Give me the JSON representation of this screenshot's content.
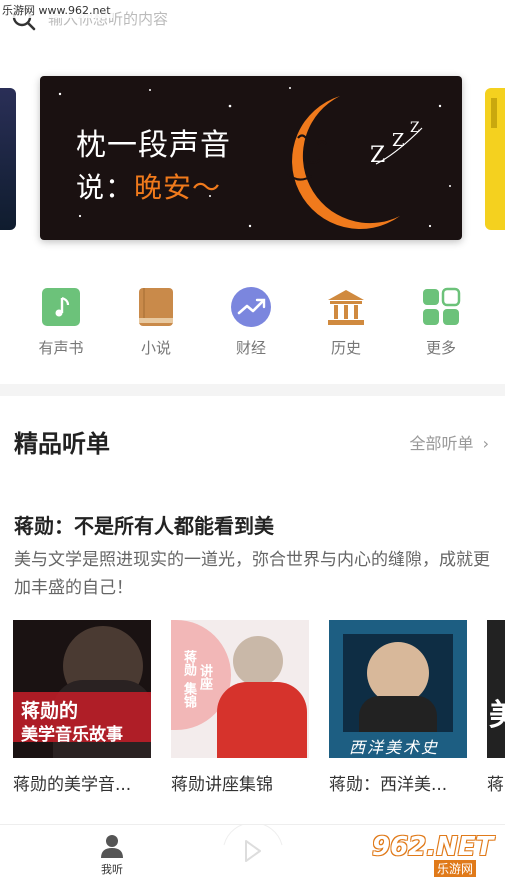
{
  "watermark_top": "乐游网 www.962.net",
  "search": {
    "placeholder": "输入你想听的内容"
  },
  "banner": {
    "line1": "枕一段声音",
    "line2_prefix": "说：",
    "line2_highlight": "晚安～",
    "snore": "z Z Z"
  },
  "categories": [
    {
      "label": "有声书",
      "icon": "music-book-icon",
      "color": "#6cc27a"
    },
    {
      "label": "小说",
      "icon": "book-icon",
      "color": "#c98a4a"
    },
    {
      "label": "财经",
      "icon": "trend-icon",
      "color": "#7b86de"
    },
    {
      "label": "历史",
      "icon": "temple-icon",
      "color": "#d08a3f"
    },
    {
      "label": "更多",
      "icon": "grid-icon",
      "color": "#6cc27a"
    }
  ],
  "section": {
    "title": "精品听单",
    "more": "全部听单"
  },
  "playlist": {
    "title": "蒋勋：不是所有人都能看到美",
    "desc": "美与文学是照进现实的一道光，弥合世界与内心的缝隙，成就更加丰盛的自己！"
  },
  "cards": [
    {
      "title": "蒋勋的美学音...",
      "cover_text_1": "蒋勋的",
      "cover_text_2": "美学音乐故事"
    },
    {
      "title": "蒋勋讲座集锦",
      "cover_text_1": "蒋勋",
      "cover_text_2": "讲座",
      "cover_text_3": "集锦"
    },
    {
      "title": "蒋勋：西洋美...",
      "cover_text_1": "西洋美术史"
    },
    {
      "title": "蒋",
      "cover_text_1": "美"
    }
  ],
  "tabbar": {
    "me_label": "我听"
  },
  "watermark_bottom": {
    "main": "962.NET",
    "sub": "乐游网"
  }
}
